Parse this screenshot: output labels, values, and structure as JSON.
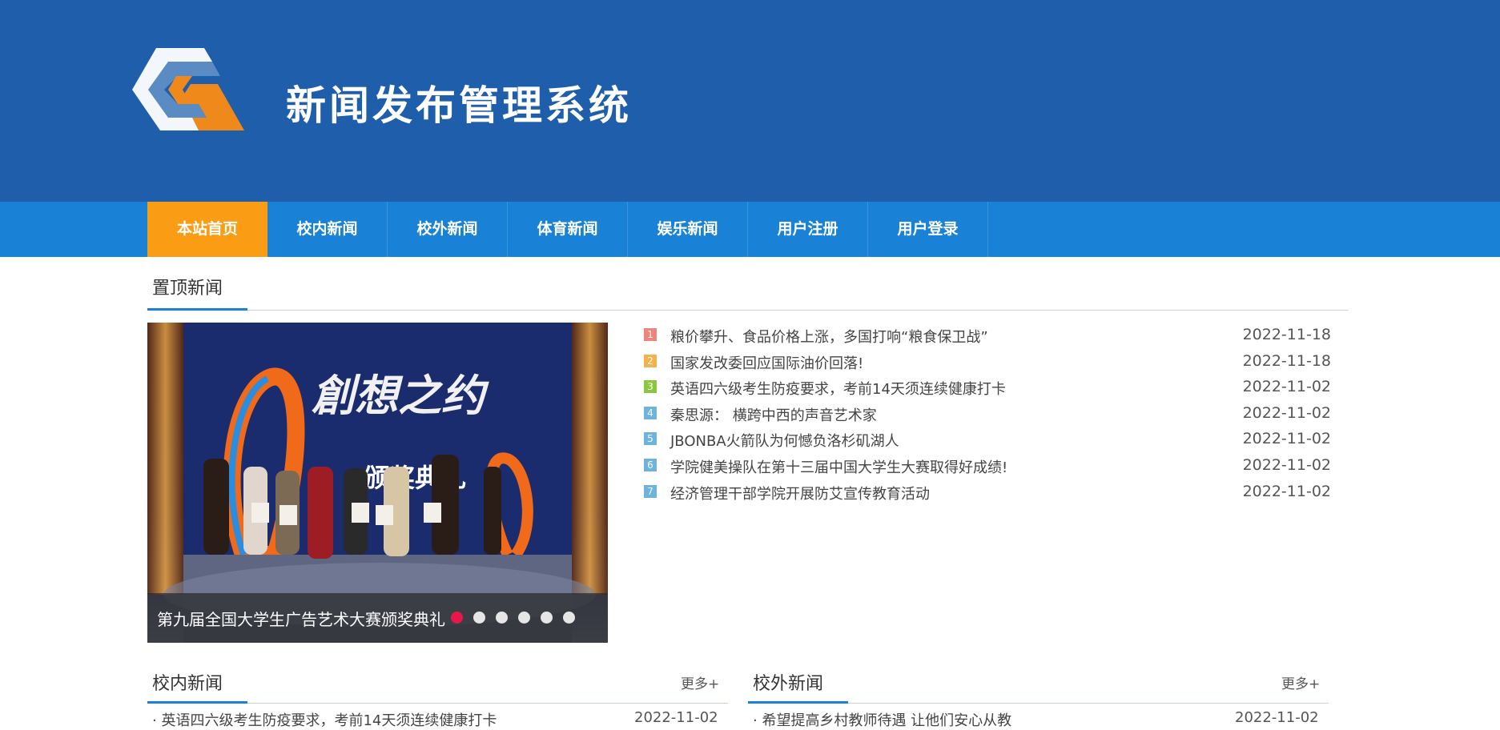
{
  "header": {
    "title": "新闻发布管理系统"
  },
  "nav": {
    "items": [
      {
        "label": "本站首页",
        "active": true
      },
      {
        "label": "校内新闻"
      },
      {
        "label": "校外新闻"
      },
      {
        "label": "体育新闻"
      },
      {
        "label": "娱乐新闻"
      },
      {
        "label": "用户注册"
      },
      {
        "label": "用户登录"
      }
    ]
  },
  "featured": {
    "heading": "置顶新闻",
    "slider": {
      "caption": "第九届全国大学生广告艺术大赛颁奖典礼",
      "dot_count": 6,
      "active_dot": 0
    },
    "list": [
      {
        "num": "1",
        "color": "#f0837a",
        "title": "粮价攀升、食品价格上涨，多国打响“粮食保卫战”",
        "date": "2022-11-18"
      },
      {
        "num": "2",
        "color": "#f6b24a",
        "title": "国家发改委回应国际油价回落!",
        "date": "2022-11-18"
      },
      {
        "num": "3",
        "color": "#8cc83f",
        "title": "英语四六级考生防疫要求，考前14天须连续健康打卡",
        "date": "2022-11-02"
      },
      {
        "num": "4",
        "color": "#6cb3dd",
        "title": "秦思源： 横跨中西的声音艺术家",
        "date": "2022-11-02"
      },
      {
        "num": "5",
        "color": "#6cb3dd",
        "title": "JBONBA火箭队为何憾负洛杉矶湖人",
        "date": "2022-11-02"
      },
      {
        "num": "6",
        "color": "#6cb3dd",
        "title": "学院健美操队在第十三届中国大学生大赛取得好成绩!",
        "date": "2022-11-02"
      },
      {
        "num": "7",
        "color": "#6cb3dd",
        "title": "经济管理干部学院开展防艾宣传教育活动",
        "date": "2022-11-02"
      }
    ]
  },
  "campus": {
    "heading": "校内新闻",
    "more": "更多+",
    "first_item": {
      "title": "英语四六级考生防疫要求，考前14天须连续健康打卡",
      "date": "2022-11-02"
    }
  },
  "outside": {
    "heading": "校外新闻",
    "more": "更多+",
    "first_item": {
      "title": "希望提高乡村教师待遇 让他们安心从教",
      "date": "2022-11-02"
    }
  },
  "colors": {
    "banner": "#1e5eab",
    "navbar": "#1a82d6",
    "nav_active": "#fa9d15",
    "dot_active": "#e8174a",
    "logo_orange": "#f0891c"
  }
}
